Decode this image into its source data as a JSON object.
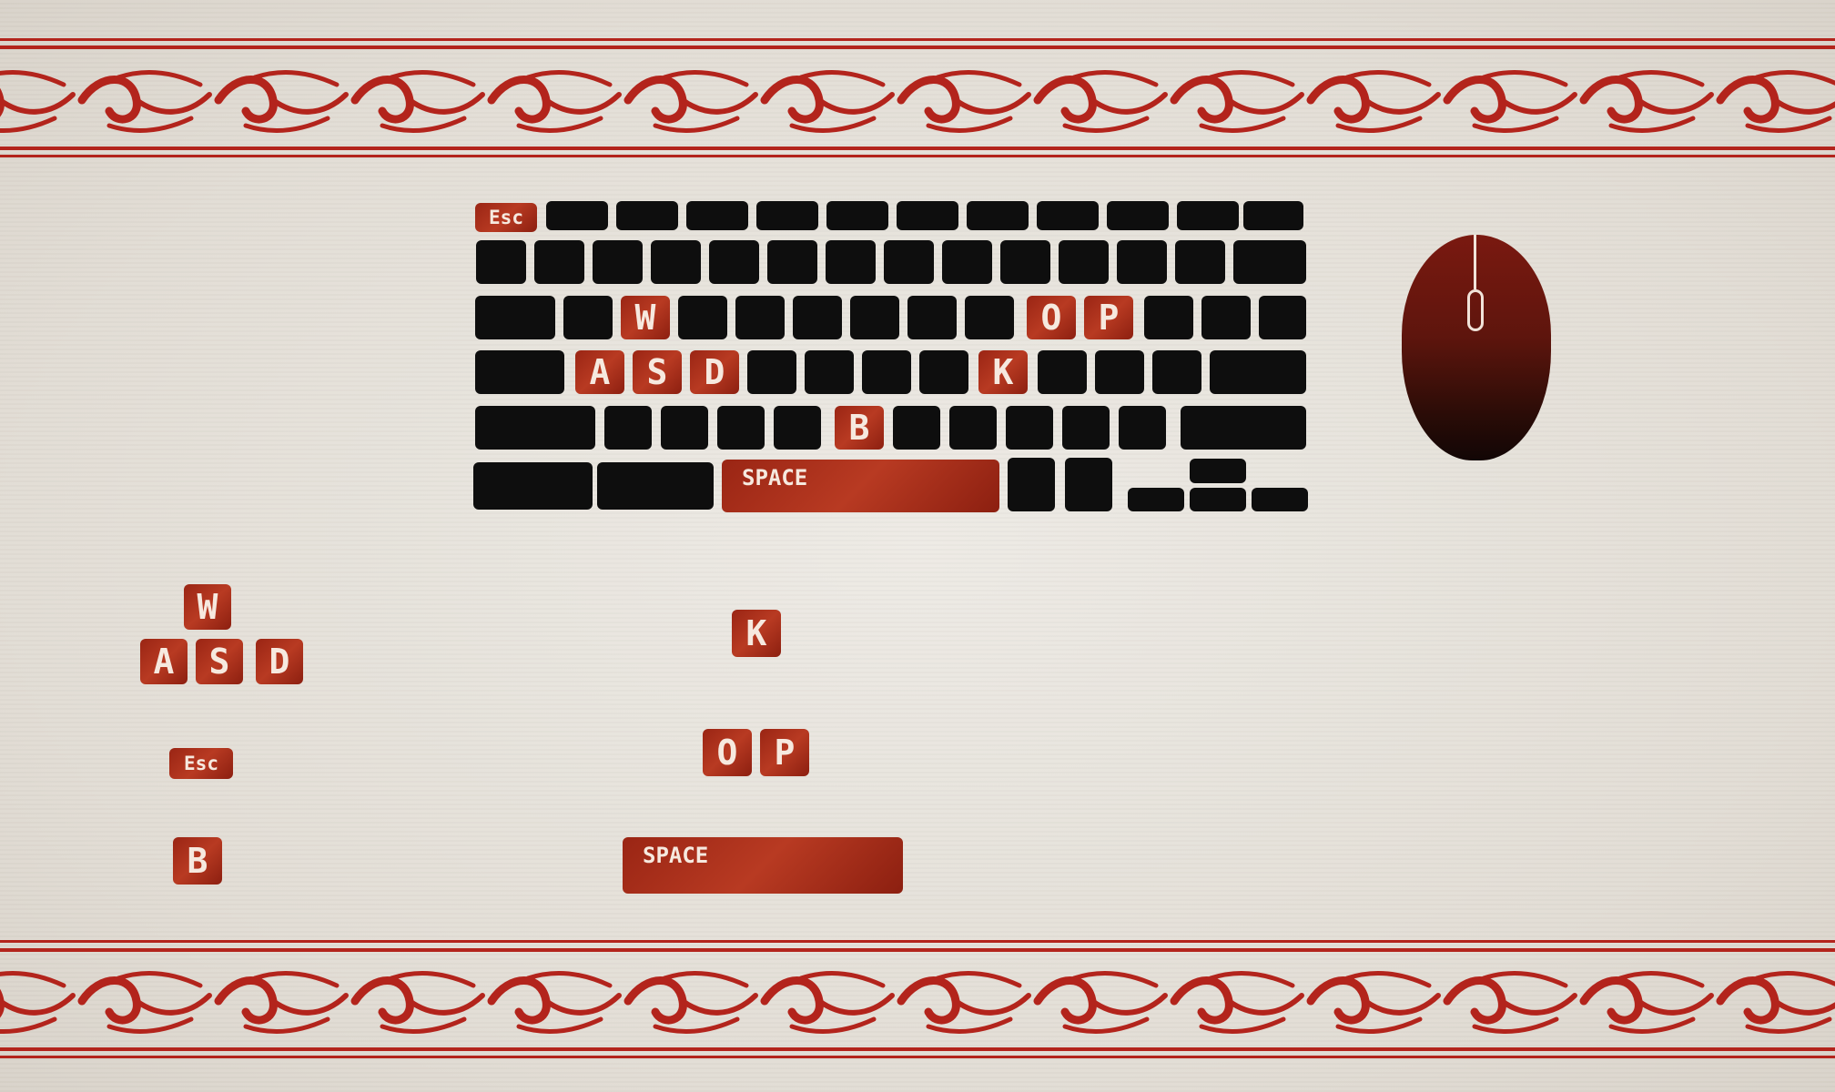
{
  "keys": {
    "esc": "Esc",
    "w": "W",
    "a": "A",
    "s": "S",
    "d": "D",
    "k": "K",
    "o": "O",
    "p": "P",
    "b": "B",
    "space": "SPACE"
  },
  "legend": {
    "movement": {
      "w": "W",
      "a": "A",
      "s": "S",
      "d": "D"
    },
    "esc": "Esc",
    "b": "B",
    "k": "K",
    "o": "O",
    "p": "P",
    "space": "SPACE"
  },
  "colors": {
    "paper": "#e9e5de",
    "ink": "#0e0e0e",
    "accent_red": "#a82b18",
    "ornament_red": "#b3241c",
    "key_text": "#f6e9df"
  },
  "icons": {
    "mouse": "computer-mouse-icon",
    "ornament": "red-scroll-wave-ornament"
  }
}
